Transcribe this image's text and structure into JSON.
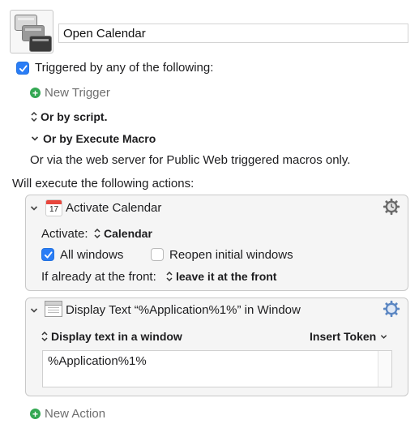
{
  "macro": {
    "name": "Open Calendar"
  },
  "triggers": {
    "header": "Triggered by any of the following:",
    "new_trigger": "New Trigger",
    "by_script": "Or by script.",
    "by_execute_macro": "Or by Execute Macro",
    "web_server_note": "Or via the web server for Public Web triggered macros only."
  },
  "actions": {
    "header": "Will execute the following actions:",
    "activate": {
      "title": "Activate Calendar",
      "activate_label": "Activate:",
      "app_value": "Calendar",
      "all_windows": "All windows",
      "reopen_windows": "Reopen initial windows",
      "front_label": "If already at the front:",
      "front_value": "leave it at the front"
    },
    "display": {
      "title": "Display Text “%Application%1%” in Window",
      "mode": "Display text in a window",
      "insert_token": "Insert Token",
      "text": "%Application%1%"
    },
    "new_action": "New Action"
  },
  "colors": {
    "accent": "#2a7df6",
    "plus_green": "#34a853"
  }
}
